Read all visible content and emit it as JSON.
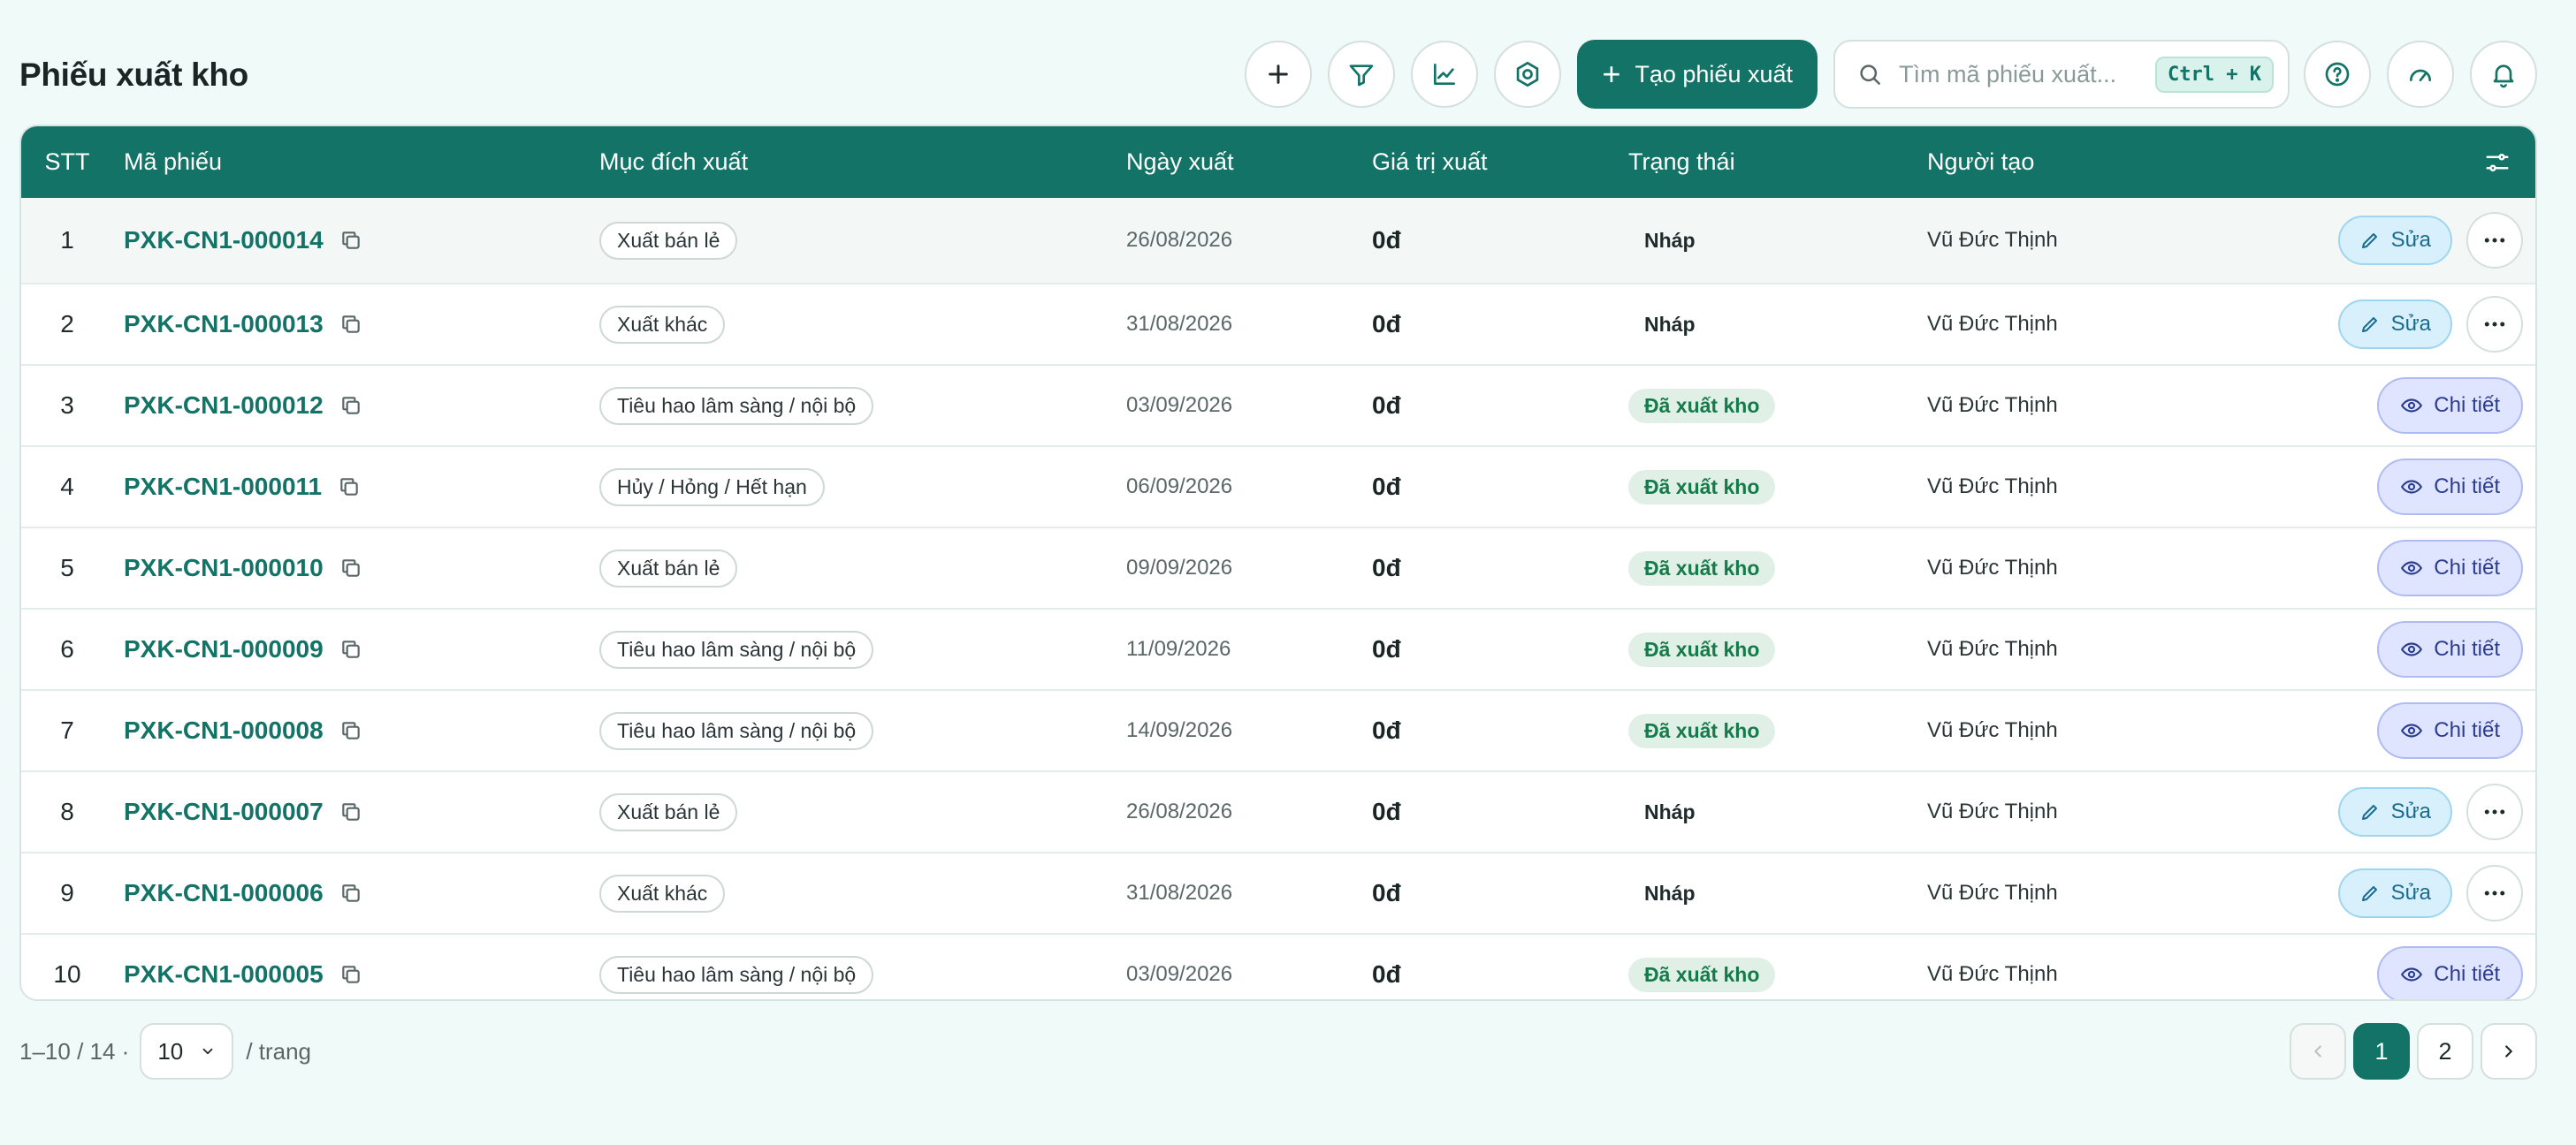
{
  "header": {
    "title": "Phiếu xuất kho",
    "create_label": "Tạo phiếu xuất",
    "search_placeholder": "Tìm mã phiếu xuất...",
    "search_shortcut": "Ctrl + K",
    "icons": [
      "plus-icon",
      "filter-icon",
      "chart-icon",
      "settings-icon",
      "help-icon",
      "gauge-icon",
      "bell-icon"
    ]
  },
  "table": {
    "columns": {
      "stt": "STT",
      "code": "Mã phiếu",
      "purpose": "Mục đích xuất",
      "date": "Ngày xuất",
      "value": "Giá trị xuất",
      "status": "Trạng thái",
      "creator": "Người tạo"
    },
    "actions": {
      "edit_label": "Sửa",
      "detail_label": "Chi tiết"
    },
    "rows": [
      {
        "stt": "1",
        "code": "PXK-CN1-000014",
        "purpose": "Xuất bán lẻ",
        "date": "26/08/2026",
        "value": "0đ",
        "status": "Nháp",
        "status_type": "draft",
        "creator": "Vũ Đức Thịnh"
      },
      {
        "stt": "2",
        "code": "PXK-CN1-000013",
        "purpose": "Xuất khác",
        "date": "31/08/2026",
        "value": "0đ",
        "status": "Nháp",
        "status_type": "draft",
        "creator": "Vũ Đức Thịnh"
      },
      {
        "stt": "3",
        "code": "PXK-CN1-000012",
        "purpose": "Tiêu hao lâm sàng / nội bộ",
        "date": "03/09/2026",
        "value": "0đ",
        "status": "Đã xuất kho",
        "status_type": "done",
        "creator": "Vũ Đức Thịnh"
      },
      {
        "stt": "4",
        "code": "PXK-CN1-000011",
        "purpose": "Hủy / Hỏng / Hết hạn",
        "date": "06/09/2026",
        "value": "0đ",
        "status": "Đã xuất kho",
        "status_type": "done",
        "creator": "Vũ Đức Thịnh"
      },
      {
        "stt": "5",
        "code": "PXK-CN1-000010",
        "purpose": "Xuất bán lẻ",
        "date": "09/09/2026",
        "value": "0đ",
        "status": "Đã xuất kho",
        "status_type": "done",
        "creator": "Vũ Đức Thịnh"
      },
      {
        "stt": "6",
        "code": "PXK-CN1-000009",
        "purpose": "Tiêu hao lâm sàng / nội bộ",
        "date": "11/09/2026",
        "value": "0đ",
        "status": "Đã xuất kho",
        "status_type": "done",
        "creator": "Vũ Đức Thịnh"
      },
      {
        "stt": "7",
        "code": "PXK-CN1-000008",
        "purpose": "Tiêu hao lâm sàng / nội bộ",
        "date": "14/09/2026",
        "value": "0đ",
        "status": "Đã xuất kho",
        "status_type": "done",
        "creator": "Vũ Đức Thịnh"
      },
      {
        "stt": "8",
        "code": "PXK-CN1-000007",
        "purpose": "Xuất bán lẻ",
        "date": "26/08/2026",
        "value": "0đ",
        "status": "Nháp",
        "status_type": "draft",
        "creator": "Vũ Đức Thịnh"
      },
      {
        "stt": "9",
        "code": "PXK-CN1-000006",
        "purpose": "Xuất khác",
        "date": "31/08/2026",
        "value": "0đ",
        "status": "Nháp",
        "status_type": "draft",
        "creator": "Vũ Đức Thịnh"
      },
      {
        "stt": "10",
        "code": "PXK-CN1-000005",
        "purpose": "Tiêu hao lâm sàng / nội bộ",
        "date": "03/09/2026",
        "value": "0đ",
        "status": "Đã xuất kho",
        "status_type": "done",
        "creator": "Vũ Đức Thịnh"
      }
    ]
  },
  "footer": {
    "range_text": "1–10 / 14 ·",
    "page_size": "10",
    "per_page_label": "/ trang",
    "pages": [
      "1",
      "2"
    ],
    "current_page": "1"
  },
  "colors": {
    "primary": "#137367",
    "background": "#f0faf8",
    "status_done_bg": "#e0f0e6",
    "edit_bg": "#d8f0fb",
    "detail_bg": "#dfe5ff"
  }
}
